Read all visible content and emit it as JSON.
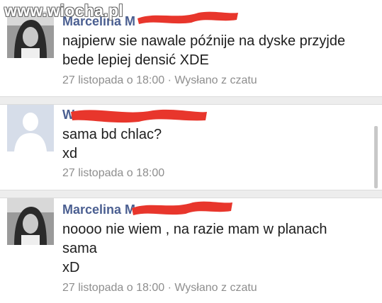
{
  "watermark": "www.wiocha.pl",
  "messages": [
    {
      "sender": "Marcelina M",
      "avatar": "female-photo",
      "lines": [
        "najpierw sie nawale późnije na dyske przyjde",
        "bede lepiej densić XDE"
      ],
      "timestamp": "27 listopada o 18:00",
      "via": " · Wysłano z czatu"
    },
    {
      "sender": "W",
      "avatar": "default-silhouette",
      "lines": [
        "sama bd chlac?",
        "xd"
      ],
      "timestamp": "27 listopada o 18:00",
      "via": ""
    },
    {
      "sender": "Marcelina M",
      "avatar": "female-photo",
      "lines": [
        "noooo nie wiem , na razie mam w planach",
        "sama",
        "xD"
      ],
      "timestamp": "27 listopada o 18:00",
      "via": " · Wysłano z czatu"
    }
  ],
  "colors": {
    "name": "#4b5f91",
    "redaction": "#e8362c",
    "meta": "#8e8e8e"
  }
}
